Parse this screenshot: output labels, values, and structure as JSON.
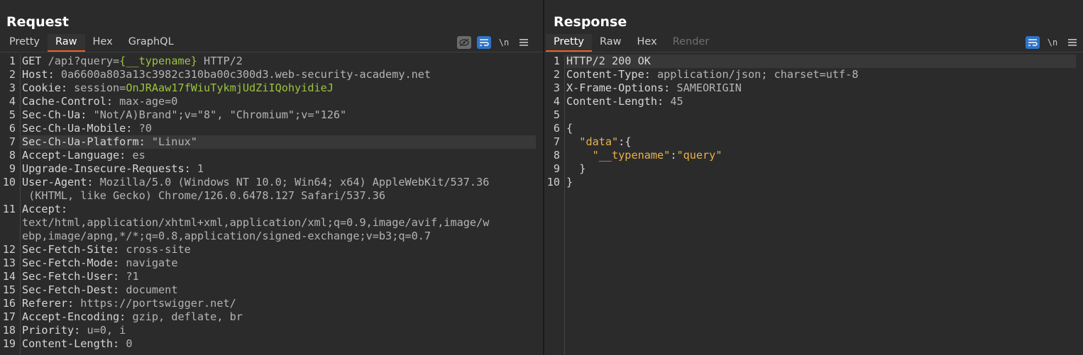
{
  "request": {
    "title": "Request",
    "tabs": [
      {
        "label": "Pretty",
        "active": false
      },
      {
        "label": "Raw",
        "active": true
      },
      {
        "label": "Hex",
        "active": false
      },
      {
        "label": "GraphQL",
        "active": false
      }
    ],
    "newline_toggle": "\\n",
    "lines": [
      {
        "n": "1",
        "parts": [
          [
            "k",
            "GET "
          ],
          [
            "v",
            "/api?query="
          ],
          [
            "g",
            "{__typename}"
          ],
          [
            "v",
            " HTTP/2"
          ]
        ]
      },
      {
        "n": "2",
        "parts": [
          [
            "k",
            "Host: "
          ],
          [
            "v",
            "0a6600a803a13c3982c310ba00c300d3.web-security-academy.net"
          ]
        ]
      },
      {
        "n": "3",
        "parts": [
          [
            "k",
            "Cookie: "
          ],
          [
            "v",
            "session="
          ],
          [
            "g",
            "OnJRAaw17fWiuTykmjUdZiIQohyidieJ"
          ]
        ]
      },
      {
        "n": "4",
        "parts": [
          [
            "k",
            "Cache-Control: "
          ],
          [
            "v",
            "max-age=0"
          ]
        ]
      },
      {
        "n": "5",
        "parts": [
          [
            "k",
            "Sec-Ch-Ua: "
          ],
          [
            "v",
            "\"Not/A)Brand\";v=\"8\", \"Chromium\";v=\"126\""
          ]
        ]
      },
      {
        "n": "6",
        "parts": [
          [
            "k",
            "Sec-Ch-Ua-Mobile: "
          ],
          [
            "v",
            "?0"
          ]
        ]
      },
      {
        "n": "7",
        "hl": true,
        "parts": [
          [
            "k",
            "Sec-Ch-Ua-Platform: "
          ],
          [
            "v",
            "\"Linux\""
          ]
        ]
      },
      {
        "n": "8",
        "parts": [
          [
            "k",
            "Accept-Language: "
          ],
          [
            "v",
            "es"
          ]
        ]
      },
      {
        "n": "9",
        "parts": [
          [
            "k",
            "Upgrade-Insecure-Requests: "
          ],
          [
            "v",
            "1"
          ]
        ]
      },
      {
        "n": "10",
        "parts": [
          [
            "k",
            "User-Agent: "
          ],
          [
            "v",
            "Mozilla/5.0 (Windows NT 10.0; Win64; x64) AppleWebKit/537.36"
          ]
        ]
      },
      {
        "n": "",
        "parts": [
          [
            "v",
            " (KHTML, like Gecko) Chrome/126.0.6478.127 Safari/537.36"
          ]
        ]
      },
      {
        "n": "11",
        "parts": [
          [
            "k",
            "Accept:"
          ]
        ]
      },
      {
        "n": "",
        "parts": [
          [
            "v",
            "text/html,application/xhtml+xml,application/xml;q=0.9,image/avif,image/w"
          ]
        ]
      },
      {
        "n": "",
        "parts": [
          [
            "v",
            "ebp,image/apng,*/*;q=0.8,application/signed-exchange;v=b3;q=0.7"
          ]
        ]
      },
      {
        "n": "12",
        "parts": [
          [
            "k",
            "Sec-Fetch-Site: "
          ],
          [
            "v",
            "cross-site"
          ]
        ]
      },
      {
        "n": "13",
        "parts": [
          [
            "k",
            "Sec-Fetch-Mode: "
          ],
          [
            "v",
            "navigate"
          ]
        ]
      },
      {
        "n": "14",
        "parts": [
          [
            "k",
            "Sec-Fetch-User: "
          ],
          [
            "v",
            "?1"
          ]
        ]
      },
      {
        "n": "15",
        "parts": [
          [
            "k",
            "Sec-Fetch-Dest: "
          ],
          [
            "v",
            "document"
          ]
        ]
      },
      {
        "n": "16",
        "parts": [
          [
            "k",
            "Referer: "
          ],
          [
            "v",
            "https://portswigger.net/"
          ]
        ]
      },
      {
        "n": "17",
        "parts": [
          [
            "k",
            "Accept-Encoding: "
          ],
          [
            "v",
            "gzip, deflate, br"
          ]
        ]
      },
      {
        "n": "18",
        "parts": [
          [
            "k",
            "Priority: "
          ],
          [
            "v",
            "u=0, i"
          ]
        ]
      },
      {
        "n": "19",
        "parts": [
          [
            "k",
            "Content-Length: "
          ],
          [
            "v",
            "0"
          ]
        ]
      }
    ]
  },
  "response": {
    "title": "Response",
    "tabs": [
      {
        "label": "Pretty",
        "active": true
      },
      {
        "label": "Raw",
        "active": false
      },
      {
        "label": "Hex",
        "active": false
      },
      {
        "label": "Render",
        "active": false,
        "disabled": true
      }
    ],
    "newline_toggle": "\\n",
    "lines": [
      {
        "n": "1",
        "hl": true,
        "parts": [
          [
            "k",
            "HTTP/2 200 OK"
          ]
        ]
      },
      {
        "n": "2",
        "parts": [
          [
            "k",
            "Content-Type: "
          ],
          [
            "v",
            "application/json; charset=utf-8"
          ]
        ]
      },
      {
        "n": "3",
        "parts": [
          [
            "k",
            "X-Frame-Options: "
          ],
          [
            "v",
            "SAMEORIGIN"
          ]
        ]
      },
      {
        "n": "4",
        "parts": [
          [
            "k",
            "Content-Length: "
          ],
          [
            "v",
            "45"
          ]
        ]
      },
      {
        "n": "5",
        "parts": []
      },
      {
        "n": "6",
        "parts": [
          [
            "k",
            "{"
          ]
        ]
      },
      {
        "n": "7",
        "parts": [
          [
            "k",
            "  "
          ],
          [
            "s",
            "\"data\""
          ],
          [
            "k",
            ":{"
          ]
        ]
      },
      {
        "n": "8",
        "parts": [
          [
            "k",
            "    "
          ],
          [
            "s",
            "\"__typename\""
          ],
          [
            "k",
            ":"
          ],
          [
            "s",
            "\"query\""
          ]
        ]
      },
      {
        "n": "9",
        "parts": [
          [
            "k",
            "  }"
          ]
        ]
      },
      {
        "n": "10",
        "parts": [
          [
            "k",
            "}"
          ]
        ]
      }
    ]
  }
}
